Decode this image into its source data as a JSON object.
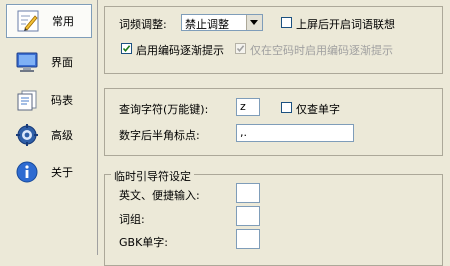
{
  "sidebar": {
    "items": [
      {
        "label": "常用",
        "icon": "text-pencil-icon",
        "selected": true
      },
      {
        "label": "界面",
        "icon": "monitor-icon",
        "selected": false
      },
      {
        "label": "码表",
        "icon": "document-icon",
        "selected": false
      },
      {
        "label": "高级",
        "icon": "gear-icon",
        "selected": false
      },
      {
        "label": "关于",
        "icon": "info-icon",
        "selected": false
      }
    ]
  },
  "freq": {
    "label": "词频调整:",
    "value": "禁止调整",
    "assoc_label": "上屏后开启词语联想",
    "assoc_checked": false,
    "progressive_label": "启用编码逐渐提示",
    "progressive_checked": true,
    "empty_code_label": "仅在空码时启用编码逐渐提示",
    "empty_code_checked": true
  },
  "query": {
    "key_label": "查询字符(万能键):",
    "key_value": "z",
    "single_label": "仅查单字",
    "single_checked": false,
    "punct_label": "数字后半角标点:",
    "punct_value": ",."
  },
  "temp": {
    "legend": "临时引导符设定",
    "english_label": "英文、便捷输入:",
    "english_value": "",
    "phrase_label": "词组:",
    "phrase_value": "",
    "gbk_label": "GBK单字:",
    "gbk_value": ""
  },
  "colors": {
    "background": "#ece9d8",
    "border": "#7f9db9",
    "disabled_text": "#a0a0a0"
  }
}
